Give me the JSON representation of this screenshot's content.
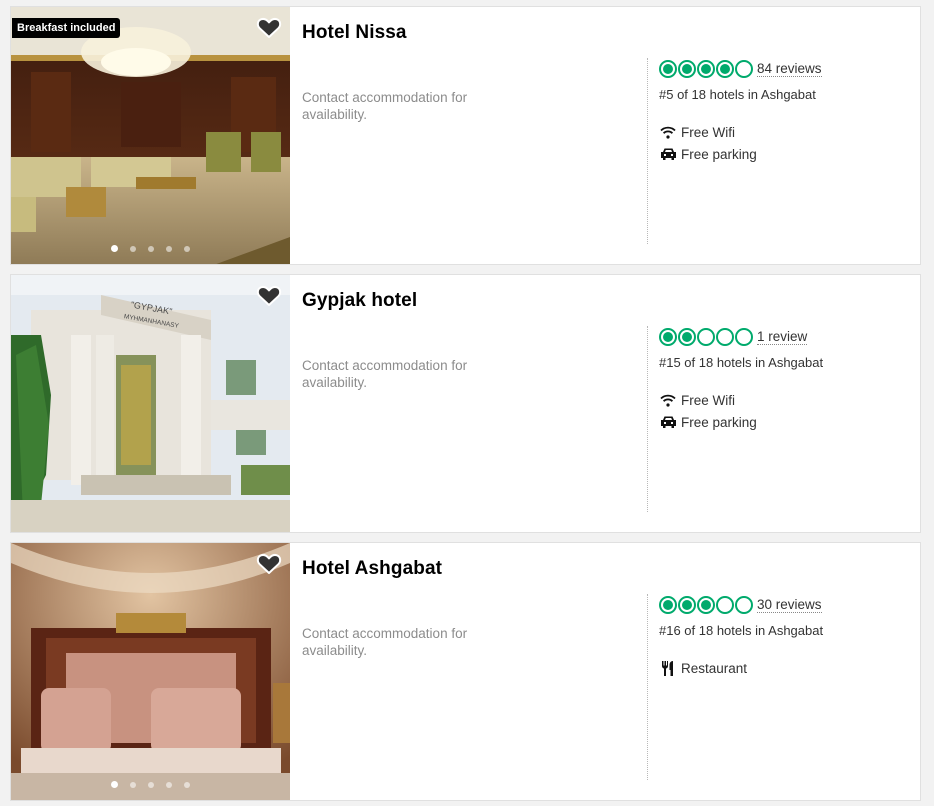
{
  "hotels": [
    {
      "name": "Hotel Nissa",
      "badge": "Breakfast included",
      "availability": "Contact accommodation for availability.",
      "rating_bubbles": 4,
      "reviews": "84 reviews",
      "rank": "#5 of 18 hotels in Ashgabat",
      "amenities": [
        {
          "icon": "wifi-icon",
          "label": "Free Wifi"
        },
        {
          "icon": "car-icon",
          "label": "Free parking"
        }
      ],
      "photo_count": 5,
      "active_photo": 0
    },
    {
      "name": "Gypjak hotel",
      "availability": "Contact accommodation for availability.",
      "rating_bubbles": 2,
      "reviews": "1 review",
      "rank": "#15 of 18 hotels in Ashgabat",
      "amenities": [
        {
          "icon": "wifi-icon",
          "label": "Free Wifi"
        },
        {
          "icon": "car-icon",
          "label": "Free parking"
        }
      ],
      "photo_sign_text": "\"GYPJAK\"\nMYHMANHANASY"
    },
    {
      "name": "Hotel Ashgabat",
      "availability": "Contact accommodation for availability.",
      "rating_bubbles": 3,
      "reviews": "30 reviews",
      "rank": "#16 of 18 hotels in Ashgabat",
      "amenities": [
        {
          "icon": "fork-knife-icon",
          "label": "Restaurant"
        }
      ],
      "photo_count": 5,
      "active_photo": 0
    }
  ],
  "colors": {
    "rating_green": "#00aa6c",
    "muted_text": "#8c8c8c",
    "card_bg": "#ffffff",
    "page_bg": "#f2f2f2"
  }
}
